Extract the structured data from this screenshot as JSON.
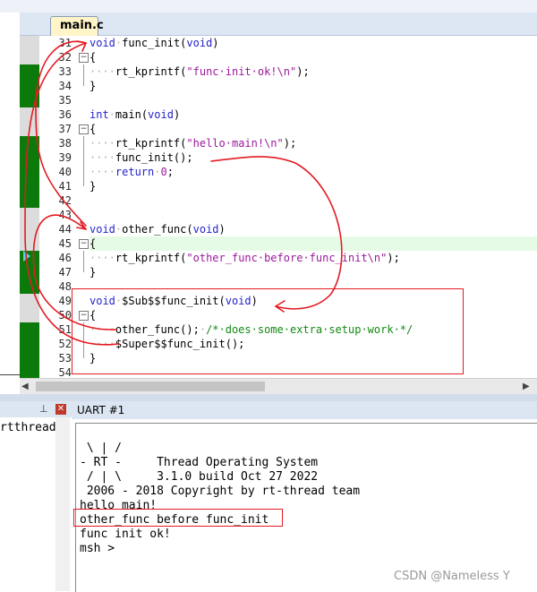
{
  "editor": {
    "tab_label": "main.c",
    "lines": [
      {
        "n": "31",
        "code": [
          [
            "kw",
            "void"
          ],
          [
            "dot",
            "·"
          ],
          [
            "t",
            "func_init("
          ],
          [
            "kw",
            "void"
          ],
          [
            "t",
            ")"
          ]
        ]
      },
      {
        "n": "32",
        "code": [
          [
            "t",
            "{"
          ]
        ]
      },
      {
        "n": "33",
        "code": [
          [
            "dot",
            "····"
          ],
          [
            "t",
            "rt_kprintf("
          ],
          [
            "str",
            "\"func·init·ok!\\n\""
          ],
          [
            "t",
            ");"
          ]
        ]
      },
      {
        "n": "34",
        "code": [
          [
            "t",
            "}"
          ]
        ]
      },
      {
        "n": "35",
        "code": []
      },
      {
        "n": "36",
        "code": [
          [
            "kw",
            "int"
          ],
          [
            "dot",
            "·"
          ],
          [
            "t",
            "main("
          ],
          [
            "kw",
            "void"
          ],
          [
            "t",
            ")"
          ]
        ]
      },
      {
        "n": "37",
        "code": [
          [
            "t",
            "{"
          ]
        ]
      },
      {
        "n": "38",
        "code": [
          [
            "dot",
            "····"
          ],
          [
            "t",
            "rt_kprintf("
          ],
          [
            "str",
            "\"hello·main!\\n\""
          ],
          [
            "t",
            ");"
          ]
        ]
      },
      {
        "n": "39",
        "code": [
          [
            "dot",
            "····"
          ],
          [
            "t",
            "func_init();"
          ]
        ]
      },
      {
        "n": "40",
        "code": [
          [
            "dot",
            "····"
          ],
          [
            "kw",
            "return"
          ],
          [
            "dot",
            "·"
          ],
          [
            "num",
            "0"
          ],
          [
            "t",
            ";"
          ]
        ]
      },
      {
        "n": "41",
        "code": [
          [
            "t",
            "}"
          ]
        ]
      },
      {
        "n": "42",
        "code": []
      },
      {
        "n": "43",
        "code": []
      },
      {
        "n": "44",
        "code": [
          [
            "kw",
            "void"
          ],
          [
            "dot",
            "·"
          ],
          [
            "t",
            "other_func("
          ],
          [
            "kw",
            "void"
          ],
          [
            "t",
            ")"
          ]
        ]
      },
      {
        "n": "45",
        "code": [
          [
            "t",
            "{"
          ]
        ]
      },
      {
        "n": "46",
        "code": [
          [
            "dot",
            "····"
          ],
          [
            "t",
            "rt_kprintf("
          ],
          [
            "str",
            "\"other_func·before·func_init\\n\""
          ],
          [
            "t",
            ");"
          ]
        ]
      },
      {
        "n": "47",
        "code": [
          [
            "t",
            "}"
          ]
        ]
      },
      {
        "n": "48",
        "code": []
      },
      {
        "n": "49",
        "code": [
          [
            "kw",
            "void"
          ],
          [
            "dot",
            "·"
          ],
          [
            "t",
            "$Sub$$func_init("
          ],
          [
            "kw",
            "void"
          ],
          [
            "t",
            ")"
          ]
        ]
      },
      {
        "n": "50",
        "code": [
          [
            "t",
            "{"
          ]
        ]
      },
      {
        "n": "51",
        "code": [
          [
            "dot",
            "····"
          ],
          [
            "t",
            "other_func();"
          ],
          [
            "dot",
            "·"
          ],
          [
            "cm",
            "/*·does·some·extra·setup·work·*/"
          ]
        ]
      },
      {
        "n": "52",
        "code": [
          [
            "dot",
            "····"
          ],
          [
            "t",
            "$Super$$func_init();"
          ]
        ]
      },
      {
        "n": "53",
        "code": [
          [
            "t",
            "}"
          ]
        ]
      },
      {
        "n": "54",
        "code": []
      }
    ]
  },
  "left_panel": {
    "text": "rtthread"
  },
  "uart": {
    "title": "UART #1",
    "lines": [
      "",
      " \\ | /",
      "- RT -     Thread Operating System",
      " / | \\     3.1.0 build Oct 27 2022",
      " 2006 - 2018 Copyright by rt-thread team",
      "hello main!",
      "other_func before func_init",
      "func init ok!",
      "msh >"
    ]
  },
  "watermark": "CSDN @Nameless Y",
  "colors": {
    "annotation_red": "#e31b23",
    "keyword_blue": "#2424c8",
    "string_purple": "#9a1a9a",
    "comment_green": "#128a12",
    "gutter_green": "#0b7a0b"
  }
}
